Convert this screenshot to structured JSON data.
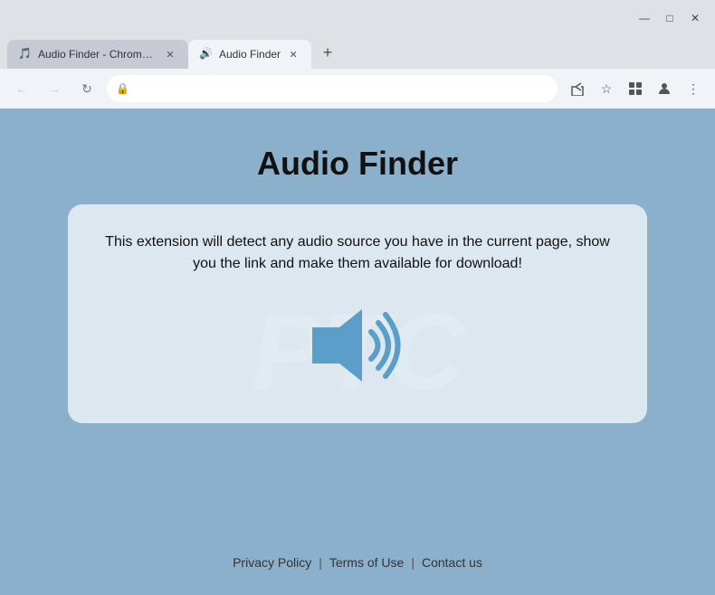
{
  "browser": {
    "tabs": [
      {
        "id": "tab1",
        "title": "Audio Finder - Chrome Web ...",
        "favicon": "🎵",
        "active": false
      },
      {
        "id": "tab2",
        "title": "Audio Finder",
        "favicon": "🔊",
        "active": true
      }
    ],
    "new_tab_label": "+",
    "address": "",
    "window_controls": {
      "minimize": "—",
      "maximize": "□",
      "close": "✕"
    },
    "nav": {
      "back": "←",
      "forward": "→",
      "reload": "↻"
    }
  },
  "page": {
    "title": "Audio Finder",
    "description": "This extension will detect any audio source you have in the current page, show you the link and make them available for download!",
    "footer": {
      "privacy_policy": "Privacy Policy",
      "separator1": "|",
      "terms_of_use": "Terms of Use",
      "separator2": "|",
      "contact_us": "Contact us"
    }
  }
}
